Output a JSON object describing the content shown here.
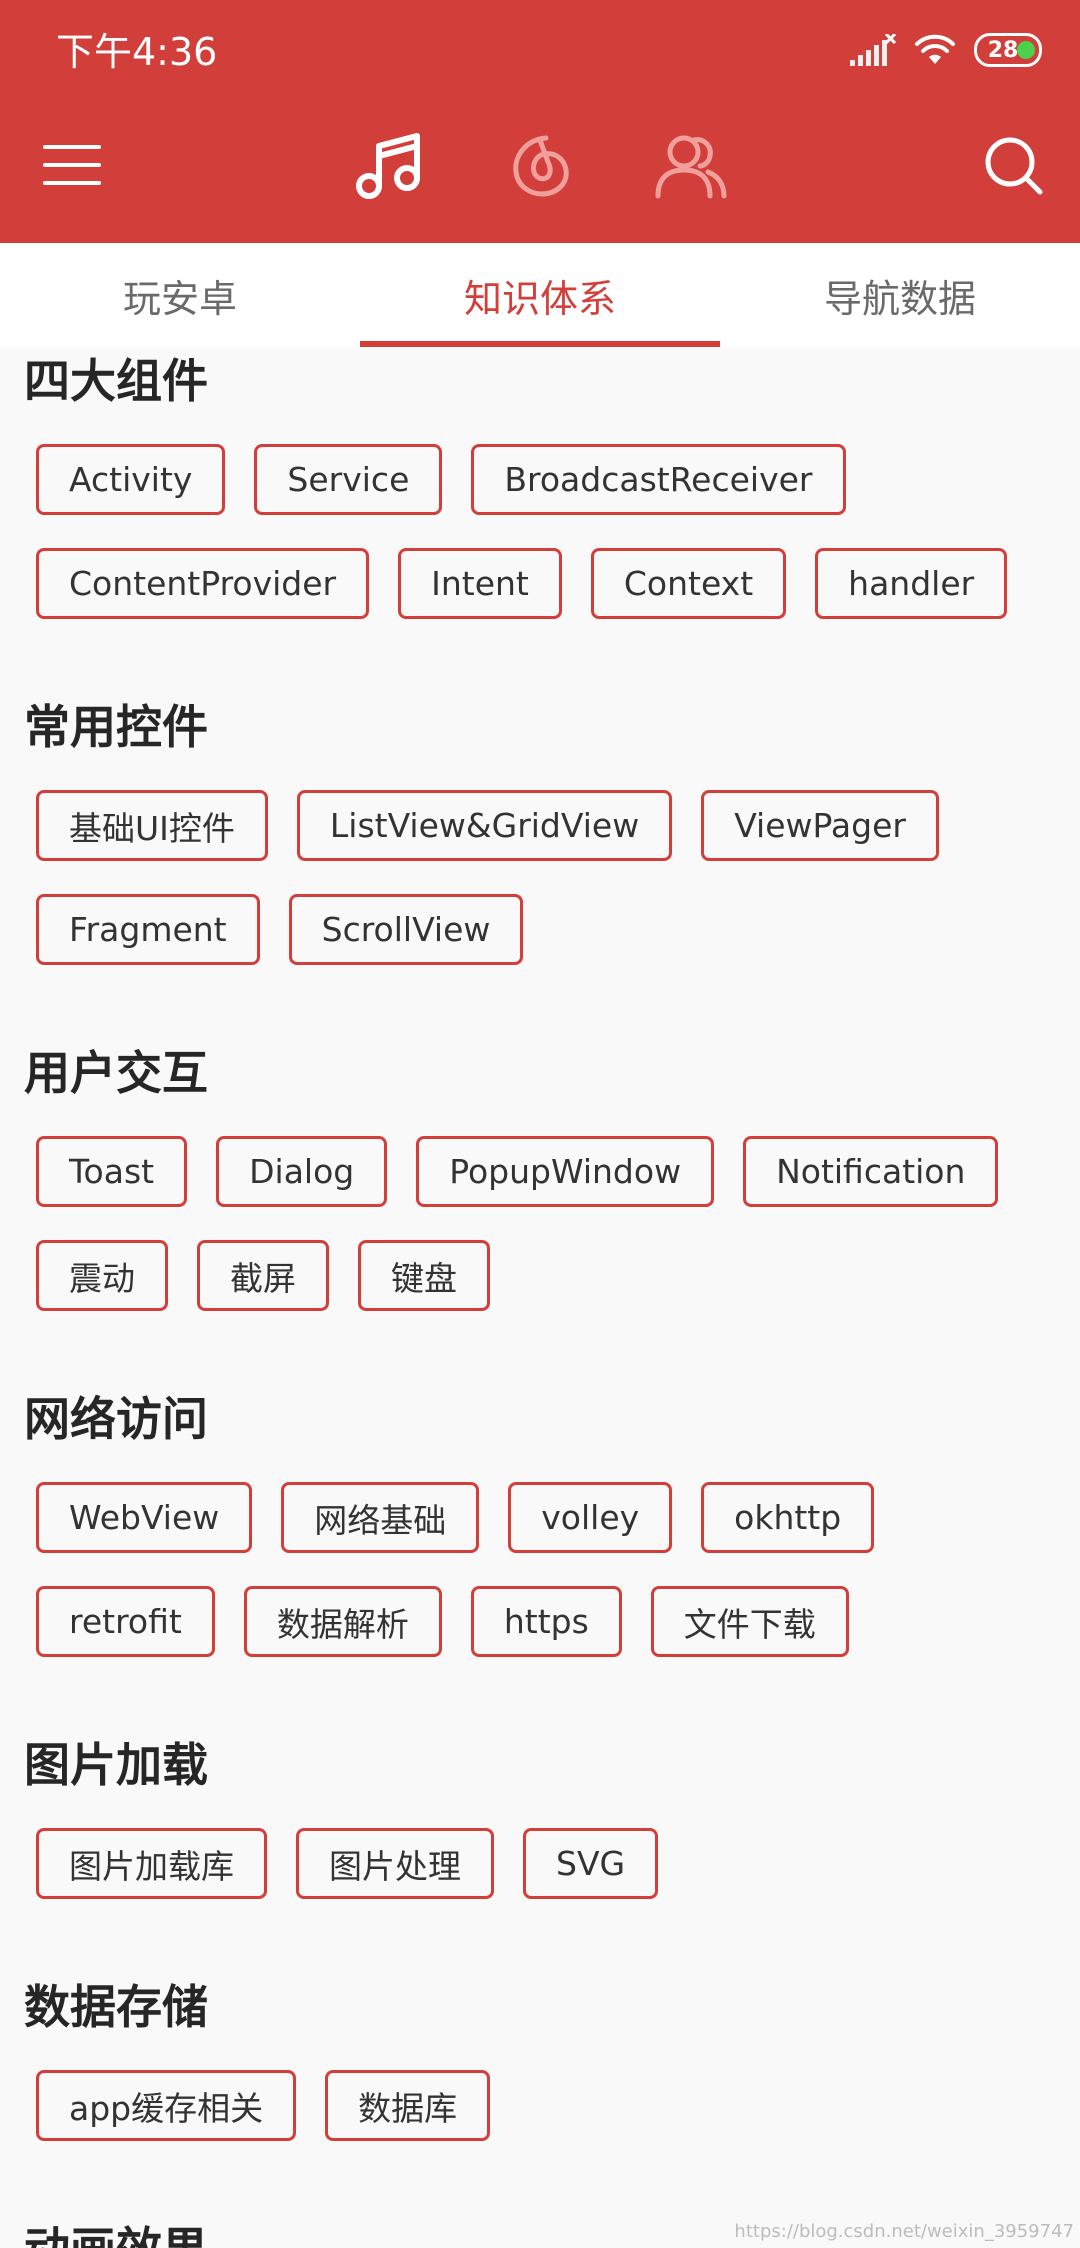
{
  "status_bar": {
    "time": "下午4:36",
    "battery": "28"
  },
  "toolbar": {
    "menu_icon": "menu-icon",
    "music_icon": "music-note-icon",
    "netease_icon": "netease-swirl-icon",
    "friends_icon": "friends-icon",
    "search_icon": "search-icon"
  },
  "tabs": [
    {
      "label": "玩安卓",
      "active": false
    },
    {
      "label": "知识体系",
      "active": true
    },
    {
      "label": "导航数据",
      "active": false
    }
  ],
  "sections": [
    {
      "title": "四大组件",
      "chips": [
        "Activity",
        "Service",
        "BroadcastReceiver",
        "ContentProvider",
        "Intent",
        "Context",
        "handler"
      ]
    },
    {
      "title": "常用控件",
      "chips": [
        "基础UI控件",
        "ListView&GridView",
        "ViewPager",
        "Fragment",
        "ScrollView"
      ]
    },
    {
      "title": "用户交互",
      "chips": [
        "Toast",
        "Dialog",
        "PopupWindow",
        "Notification",
        "震动",
        "截屏",
        "键盘"
      ]
    },
    {
      "title": "网络访问",
      "chips": [
        "WebView",
        "网络基础",
        "volley",
        "okhttp",
        "retrofit",
        "数据解析",
        "https",
        "文件下载"
      ]
    },
    {
      "title": "图片加载",
      "chips": [
        "图片加载库",
        "图片处理",
        "SVG"
      ]
    },
    {
      "title": "数据存储",
      "chips": [
        "app缓存相关",
        "数据库"
      ]
    },
    {
      "title": "动画效果",
      "chips": []
    }
  ],
  "watermark": "https://blog.csdn.net/weixin_3959747",
  "colors": {
    "accent": "#d23f3a",
    "background": "#f9f9f9",
    "battery_dot": "#4bd14b"
  }
}
